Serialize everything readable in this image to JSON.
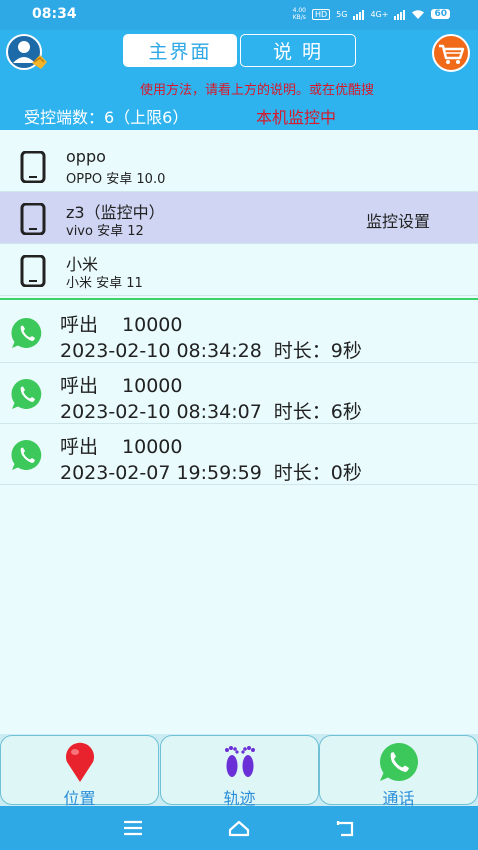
{
  "status_bar": {
    "time": "08:34",
    "net_speed_value": "4.00",
    "net_speed_unit": "KB/s",
    "hd_label": "HD",
    "sim1_label": "5G",
    "sim2_label": "4G+",
    "battery": "60"
  },
  "header": {
    "tabs": [
      {
        "label": "主界面",
        "active": true
      },
      {
        "label": "说 明",
        "active": false
      }
    ],
    "notice": "使用方法，请看上方的说明。或在优酷搜",
    "count_text": "受控端数：6（上限6）",
    "monitoring_text": "本机监控中"
  },
  "devices": [
    {
      "name": "oppo",
      "sub": "OPPO 安卓 10.0",
      "action": ""
    },
    {
      "name": "z3（监控中）",
      "sub": "vivo 安卓 12",
      "action": "监控设置"
    },
    {
      "name": "小米",
      "sub": "小米 安卓 11",
      "action": ""
    }
  ],
  "calls": [
    {
      "type": "呼出",
      "number": "10000",
      "datetime": "2023-02-10 08:34:28",
      "duration": "时长：9秒"
    },
    {
      "type": "呼出",
      "number": "10000",
      "datetime": "2023-02-10 08:34:07",
      "duration": "时长：6秒"
    },
    {
      "type": "呼出",
      "number": "10000",
      "datetime": "2023-02-07 19:59:59",
      "duration": "时长：0秒"
    }
  ],
  "bottom_buttons": [
    {
      "label": "位置",
      "icon": "location-pin-icon"
    },
    {
      "label": "轨迹",
      "icon": "footprints-icon"
    },
    {
      "label": "通话",
      "icon": "whatsapp-call-icon"
    }
  ],
  "colors": {
    "header_blue": "#2fb3ef",
    "alert_red": "#d8192b",
    "selected_row": "#cfd5f2",
    "divider_green": "#3bd36a",
    "whatsapp_green": "#3cc85a"
  }
}
